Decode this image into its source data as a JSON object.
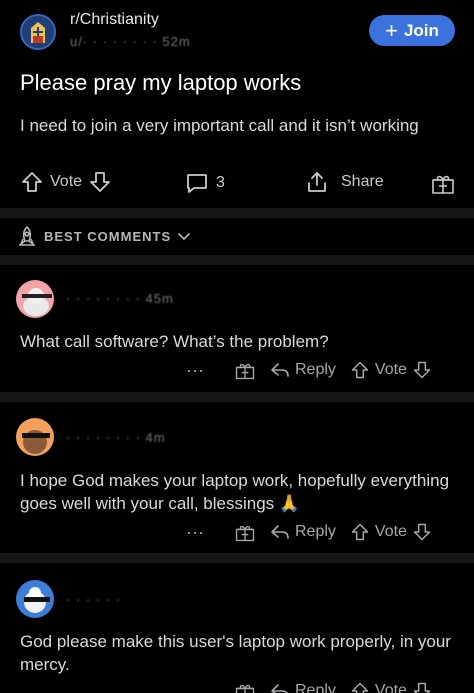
{
  "header": {
    "subreddit": "r/Christianity",
    "meta": "u/· · · · · · · · 52m",
    "join_label": "Join"
  },
  "post": {
    "title": "Please pray my laptop works",
    "body": "I need to join a very important call and it isn’t working",
    "vote_label": "Vote",
    "comment_count": "3",
    "share_label": "Share"
  },
  "sort": {
    "label": "BEST COMMENTS"
  },
  "comments": [
    {
      "user": "· · · · · · · · 45m",
      "text": "What call software? What’s the problem?",
      "reply_label": "Reply",
      "vote_label": "Vote"
    },
    {
      "user": "· · · · · · · · 4m",
      "text": "I hope God makes your laptop work, hopefully everything goes well with your call, blessings 🙏",
      "reply_label": "Reply",
      "vote_label": "Vote"
    },
    {
      "user": "· · · · · ·",
      "text": "God please make this user's laptop work properly, in your mercy.",
      "reply_label": "Reply",
      "vote_label": "Vote"
    }
  ],
  "colors": {
    "accent": "#3a73de",
    "background": "#000000",
    "divider": "#161617"
  }
}
